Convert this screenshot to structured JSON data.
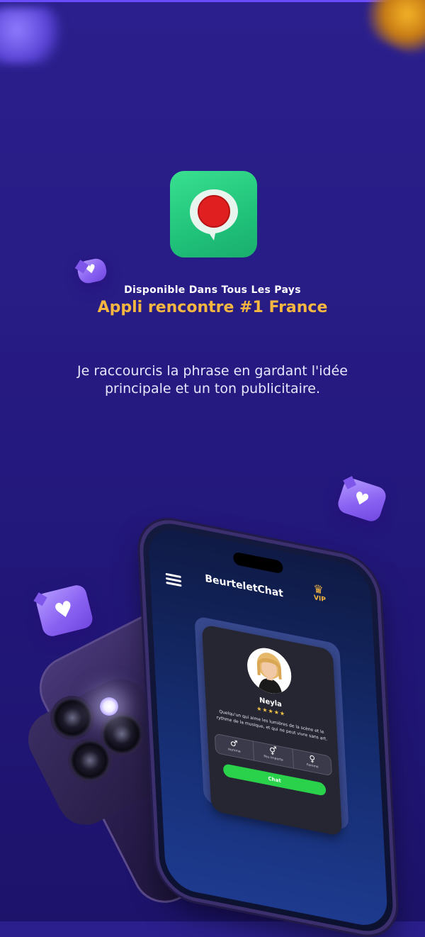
{
  "colors": {
    "background": "#2a1f8c",
    "accent": "#f5b740",
    "app_icon": "#2ad98a",
    "chat_button": "#2ad14a"
  },
  "icons": {
    "app_icon": "map-pin-icon",
    "bubble_icon": "heart-bubble-icon",
    "menu_icon": "hamburger-menu-icon",
    "crown_icon": "crown-icon"
  },
  "hero": {
    "availability": "Disponible Dans Tous Les Pays",
    "headline": "Appli rencontre #1 France",
    "subtext": "Je raccourcis la phrase en gardant l'idée principale et un ton publicitaire."
  },
  "phone": {
    "app_name": "BeurteletChat",
    "vip_label": "VIP",
    "profile": {
      "name": "Neyla",
      "rating": 4,
      "max_rating": 5,
      "stars": "★★★★★",
      "description": "Quelqu'un qui aime les lumières de la scène et le rythme de la musique, et qui ne peut vivre sans art."
    },
    "genders": [
      {
        "symbol": "♂",
        "label": "Homme"
      },
      {
        "symbol": "⚥",
        "label": "Peu Importe"
      },
      {
        "symbol": "♀",
        "label": "Femme"
      }
    ],
    "chat_button": "Chat"
  }
}
